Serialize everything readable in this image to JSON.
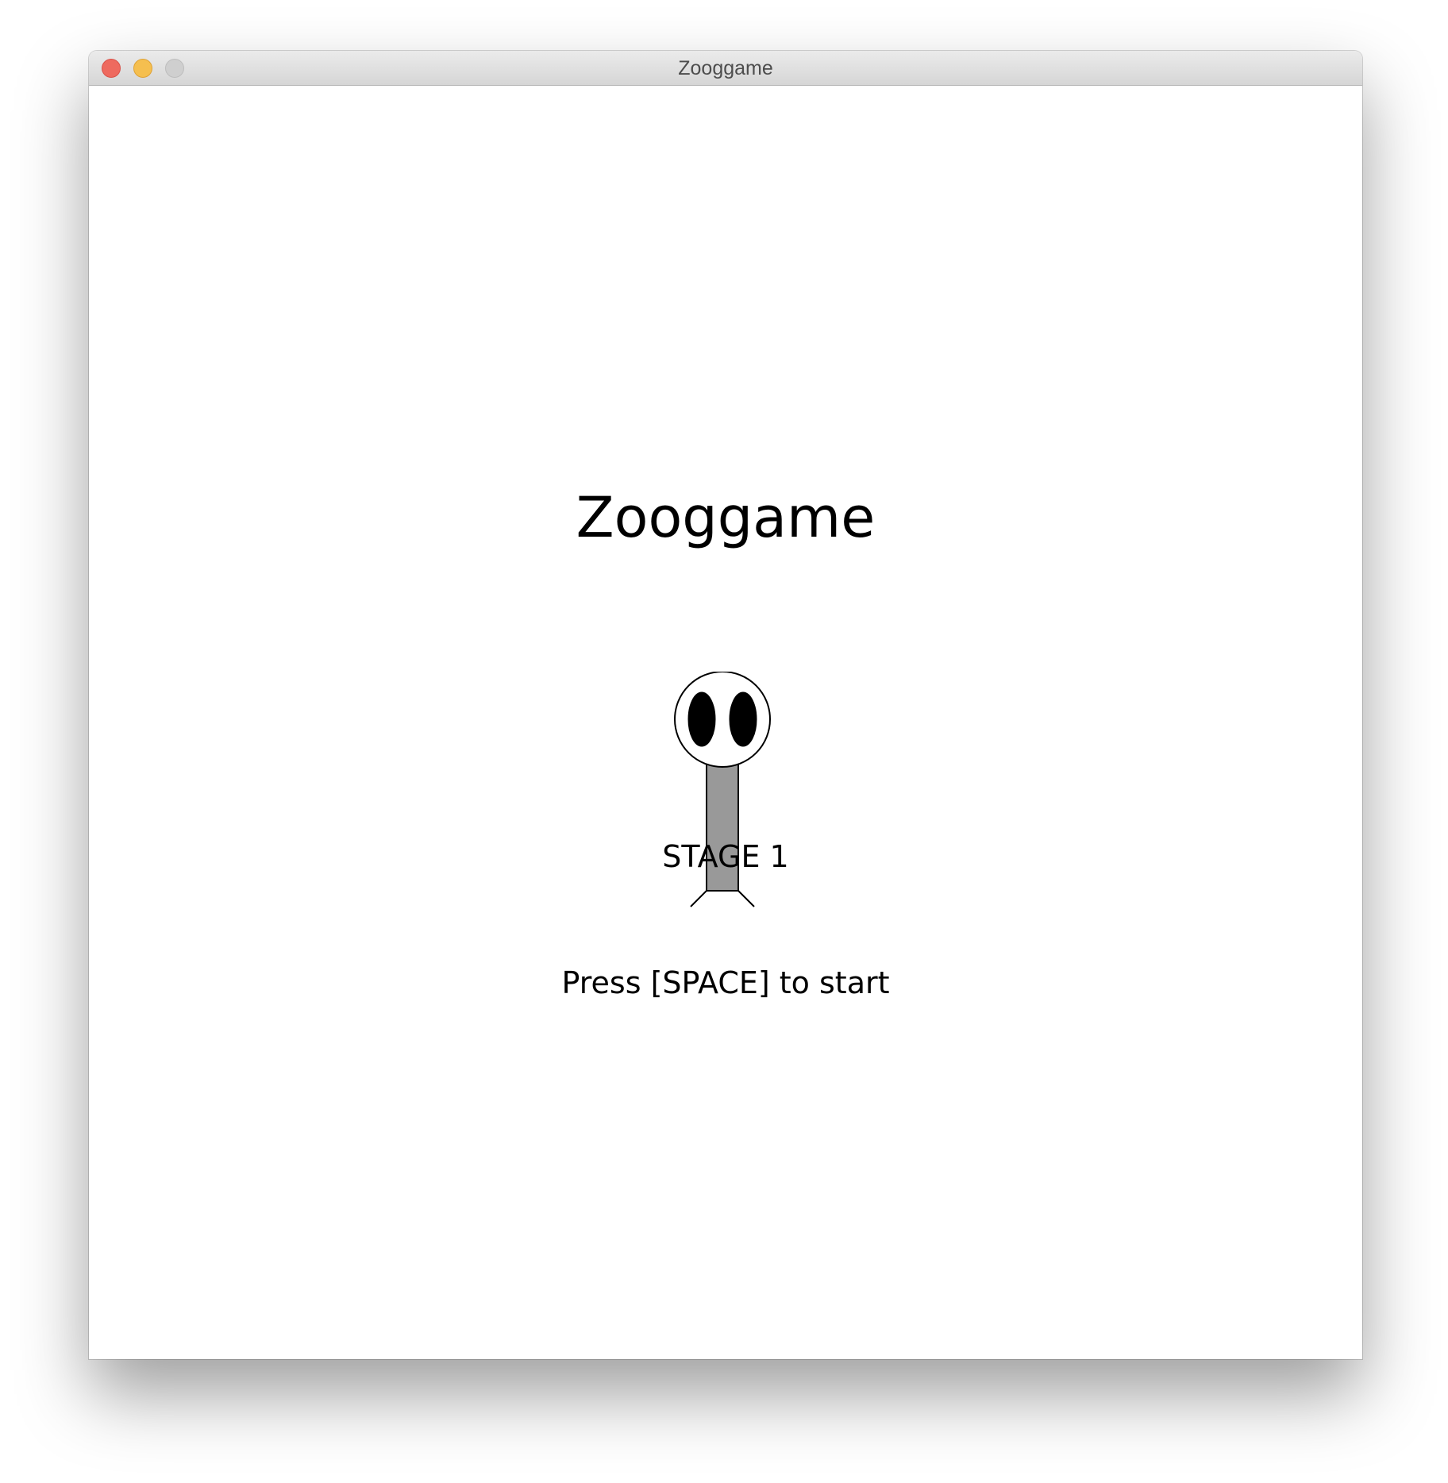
{
  "window": {
    "title": "Zooggame"
  },
  "game": {
    "title": "Zooggame",
    "stage_label": "STAGE 1",
    "prompt": "Press [SPACE] to start"
  },
  "colors": {
    "zoog_body": "#999999",
    "zoog_eyes": "#000000",
    "zoog_head": "#ffffff",
    "background": "#ffffff"
  }
}
